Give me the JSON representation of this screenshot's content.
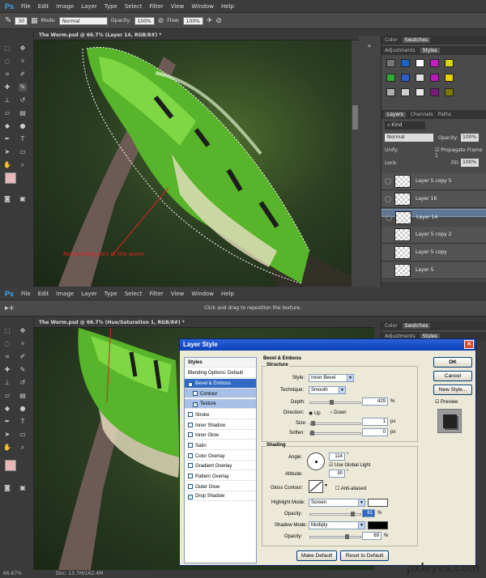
{
  "top": {
    "menu": [
      "File",
      "Edit",
      "Image",
      "Layer",
      "Type",
      "Select",
      "Filter",
      "View",
      "Window",
      "Help"
    ],
    "app_logo": "Ps",
    "options": {
      "brush_size": "30",
      "mode_label": "Mode:",
      "mode_value": "Normal",
      "opacity_label": "Opacity:",
      "opacity_value": "100%",
      "flow_label": "Flow:",
      "flow_value": "100%"
    },
    "doc_tab": "The Worm.psd @ 66.7% (Layer 14, RGB/8#) *",
    "annotation": "Retouching part of the worm",
    "panel_tabs_top": [
      "Color",
      "Swatches"
    ],
    "panel_tabs_mid": [
      "Adjustments",
      "Styles"
    ],
    "layers_tabs": [
      "Layers",
      "Channels",
      "Paths"
    ],
    "layers_kind": "Kind",
    "blend_mode": "Normal",
    "opacity_label": "Opacity:",
    "opacity_value": "100%",
    "unify_label": "Unify:",
    "propagate_label": "Propagate Frame 1",
    "lock_label": "Lock:",
    "fill_label": "Fill:",
    "fill_value": "100%",
    "layers": [
      "Layer 5 copy 5",
      "Layer 16",
      "Layer 14",
      "Layer 5 copy 2",
      "Layer 5 copy",
      "Layer 5"
    ],
    "style_colors": [
      "#777777",
      "#1a66c8",
      "#ffffff",
      "#c21ec2",
      "#d6d600",
      "#33a833",
      "#2b5fc8",
      "#dddddd",
      "#b91ab9",
      "#e5d000",
      "#b0b0b0",
      "#d0d0d0",
      "#e8e8e8",
      "#7a1a7a",
      "#7a7a00"
    ]
  },
  "bottom": {
    "menu": [
      "File",
      "Edit",
      "Image",
      "Layer",
      "Type",
      "Select",
      "Filter",
      "View",
      "Window",
      "Help"
    ],
    "app_logo": "Ps",
    "hint": "Click and drag to reposition the texture.",
    "doc_tab": "The Worm.psd @ 66.7% (Hue/Saturation 1, RGB/8#) *",
    "panel_tabs_top": [
      "Color",
      "Swatches"
    ],
    "panel_tabs_mid": [
      "Adjustments",
      "Styles"
    ],
    "status_zoom": "66.67%",
    "status_doc": "Doc: 13.7M/162.4M"
  },
  "dialog": {
    "title": "Layer Style",
    "styles_header": "Styles",
    "list": [
      {
        "label": "Blending Options: Default",
        "check": false,
        "state": "plain"
      },
      {
        "label": "Bevel & Emboss",
        "check": true,
        "state": "active"
      },
      {
        "label": "Contour",
        "check": false,
        "state": "sub"
      },
      {
        "label": "Texture",
        "check": true,
        "state": "sub"
      },
      {
        "label": "Stroke",
        "check": false,
        "state": "plain"
      },
      {
        "label": "Inner Shadow",
        "check": false,
        "state": "plain"
      },
      {
        "label": "Inner Glow",
        "check": false,
        "state": "plain"
      },
      {
        "label": "Satin",
        "check": false,
        "state": "plain"
      },
      {
        "label": "Color Overlay",
        "check": false,
        "state": "plain"
      },
      {
        "label": "Gradient Overlay",
        "check": false,
        "state": "plain"
      },
      {
        "label": "Pattern Overlay",
        "check": false,
        "state": "plain"
      },
      {
        "label": "Outer Glow",
        "check": false,
        "state": "plain"
      },
      {
        "label": "Drop Shadow",
        "check": true,
        "state": "plain"
      }
    ],
    "bevel_title": "Bevel & Emboss",
    "structure_title": "Structure",
    "style_label": "Style:",
    "style_value": "Inner Bevel",
    "technique_label": "Technique:",
    "technique_value": "Smooth",
    "depth_label": "Depth:",
    "depth_value": "429",
    "direction_label": "Direction:",
    "dir_up": "Up",
    "dir_down": "Down",
    "size_label": "Size:",
    "size_value": "1",
    "soften_label": "Soften:",
    "soften_value": "0",
    "px": "px",
    "pct": "%",
    "shading_title": "Shading",
    "angle_label": "Angle:",
    "angle_value": "114",
    "global_light": "Use Global Light",
    "altitude_label": "Altitude:",
    "altitude_value": "30",
    "deg": "°",
    "gloss_label": "Gloss Contour:",
    "anti_aliased": "Anti-aliased",
    "highlight_label": "Highlight Mode:",
    "highlight_value": "Screen",
    "hl_opacity_label": "Opacity:",
    "hl_opacity_value": "81",
    "shadow_label": "Shadow Mode:",
    "shadow_value": "Multiply",
    "sh_opacity_label": "Opacity:",
    "sh_opacity_value": "69",
    "make_default": "Make Default",
    "reset_default": "Reset to Default",
    "ok": "OK",
    "cancel": "Cancel",
    "new_style": "New Style...",
    "preview": "Preview"
  },
  "watermark": "pxleyes.com"
}
